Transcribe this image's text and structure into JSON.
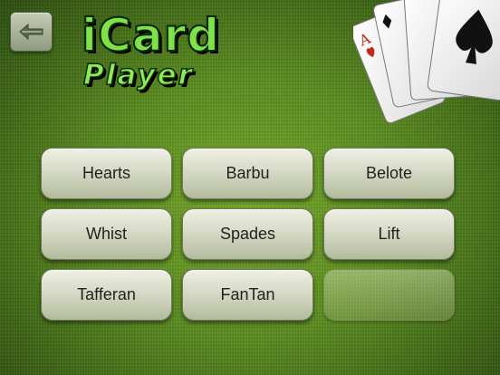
{
  "app": {
    "logo_line1": "iCard",
    "logo_line2": "Player"
  },
  "back_icon": "back-arrow-icon",
  "decor": {
    "cards_icon": "playing-cards-icon",
    "card_rank": "A"
  },
  "games": [
    {
      "label": "Hearts"
    },
    {
      "label": "Barbu"
    },
    {
      "label": "Belote"
    },
    {
      "label": "Whist"
    },
    {
      "label": "Spades"
    },
    {
      "label": "Lift"
    },
    {
      "label": "Tafferan"
    },
    {
      "label": "FanTan"
    }
  ],
  "colors": {
    "felt": "#5a8b1f",
    "logo_green": "#7fe24a",
    "button_face": "#d6dac6",
    "suit_red": "#c0281c",
    "suit_black": "#111111"
  }
}
